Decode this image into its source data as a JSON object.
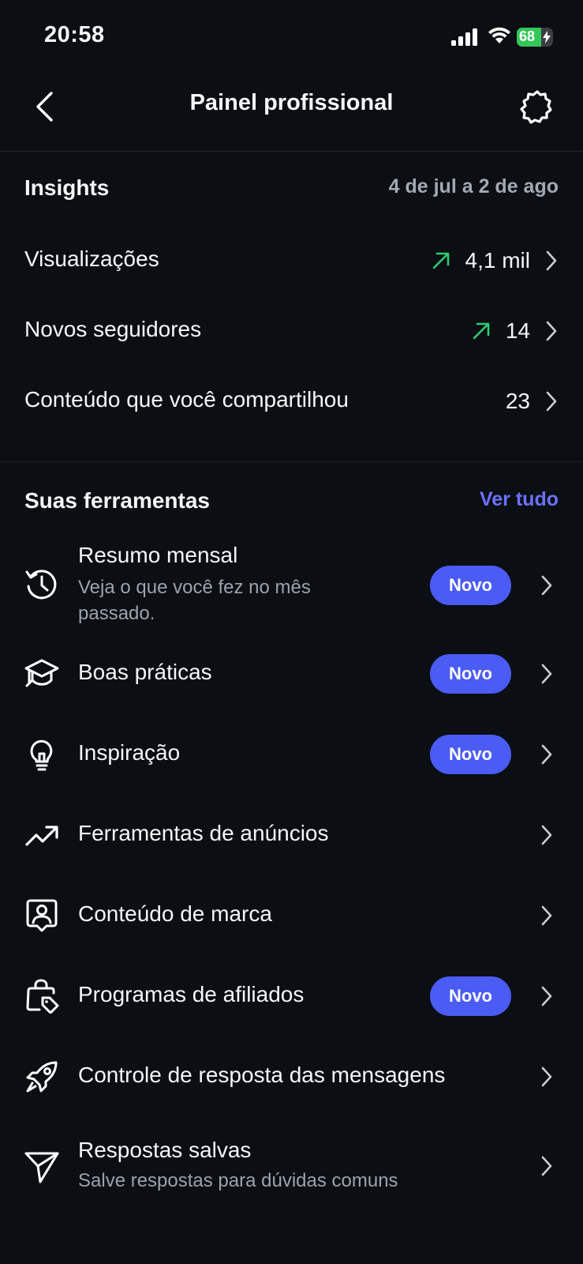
{
  "status_bar": {
    "time": "20:58",
    "battery": "68",
    "battery_level": 0.68
  },
  "nav": {
    "title": "Painel profissional",
    "back_icon": "chevron-left-icon",
    "settings_icon": "gear-icon"
  },
  "insights": {
    "title": "Insights",
    "date_range": "4 de jul a 2 de ago",
    "rows": [
      {
        "label": "Visualizações",
        "value": "4,1 mil",
        "trend": "up"
      },
      {
        "label": "Novos seguidores",
        "value": "14",
        "trend": "up"
      },
      {
        "label": "Conteúdo que você compartilhou",
        "value": "23",
        "trend": "none"
      }
    ]
  },
  "tools": {
    "title": "Suas ferramentas",
    "see_all": "Ver tudo",
    "badge_label": "Novo",
    "items": [
      {
        "title": "Resumo mensal",
        "subtitle": "Veja o que você fez no mês passado.",
        "badge": true,
        "icon": "history-clock-icon"
      },
      {
        "title": "Boas práticas",
        "badge": true,
        "icon": "graduation-cap-icon"
      },
      {
        "title": "Inspiração",
        "badge": true,
        "icon": "lightbulb-icon"
      },
      {
        "title": "Ferramentas de anúncios",
        "badge": false,
        "icon": "trending-up-icon"
      },
      {
        "title": "Conteúdo de marca",
        "badge": false,
        "icon": "branded-content-icon"
      },
      {
        "title": "Programas de afiliados",
        "badge": true,
        "icon": "shopping-bag-tag-icon"
      },
      {
        "title": "Controle de resposta das mensagens",
        "badge": false,
        "icon": "rocket-icon"
      },
      {
        "title": "Respostas salvas",
        "subtitle": "Salve respostas para dúvidas comuns",
        "badge": false,
        "icon": "send-icon"
      }
    ]
  },
  "colors": {
    "background": "#0b0e13",
    "accent": "#4a5cf3",
    "link": "#6b72ff",
    "trend_up": "#2ecc71",
    "muted": "#9da2ab"
  }
}
